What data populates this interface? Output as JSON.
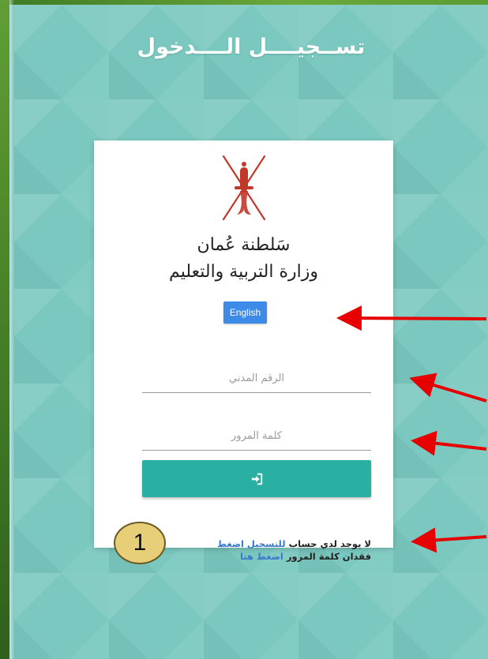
{
  "page": {
    "title": "تســجيــــل الــــدخول"
  },
  "card": {
    "ministry_line1": "سَلطنة عُمان",
    "ministry_line2": "وزارة التربية والتعليم",
    "language_button": "English",
    "civil_id_placeholder": "الرقم المدني",
    "password_placeholder": "كلمة المرور",
    "login_icon": "sign-in-icon",
    "no_account_text": "لا يوجد لدي حساب",
    "register_link": "للتسجيل اضغط",
    "forgot_text": "فقدان كلمة المرور",
    "forgot_link": "اضغط هنا"
  },
  "annotation": {
    "badge_number": "1"
  },
  "colors": {
    "background": "#7ac8bf",
    "login_button": "#2ab0a2",
    "language_button": "#3d8be8",
    "link": "#3a78c9",
    "arrow": "#e60000",
    "emblem": "#c0392b"
  }
}
